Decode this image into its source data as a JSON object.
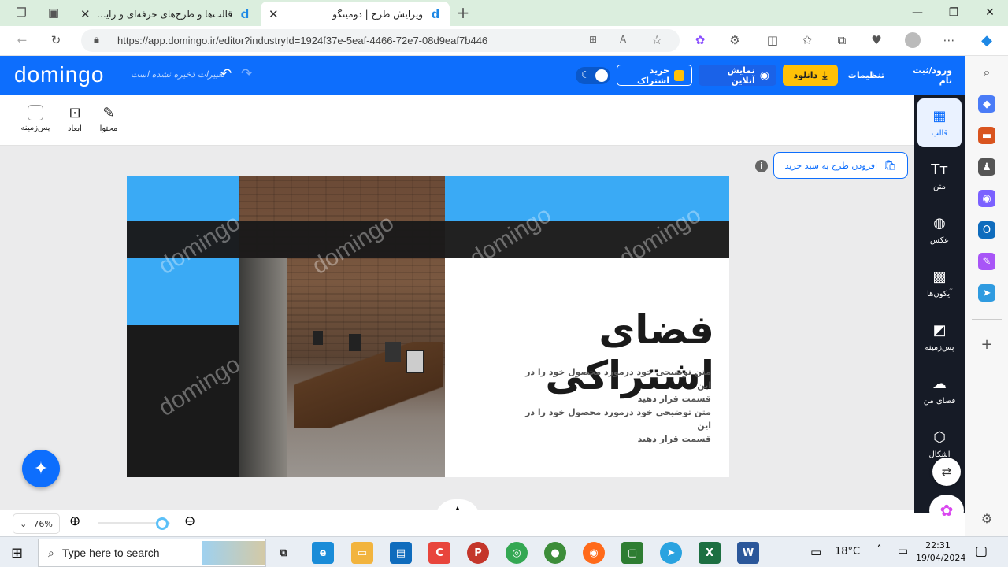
{
  "browser": {
    "tabs": [
      {
        "title": "قالب‌ها و طرح‌های حرفه‌ای و رایگان",
        "favicon": "domingo-icon",
        "active": false
      },
      {
        "title": "ویرایش طرح | دومینگو",
        "favicon": "domingo-icon",
        "active": true
      }
    ],
    "new_tab_icon": "+",
    "url": "https://app.domingo.ir/editor?industryId=1924f37e-5eaf-4466-72e7-08d9eaf7b446"
  },
  "app": {
    "logo": "domingo",
    "save_status": "تغییرات ذخیره نشده است",
    "buttons": {
      "login": "ورود/ثبت نام",
      "settings": "تنظیمات",
      "download": "دانلود",
      "preview": "نمایش آنلاین",
      "subscribe": "خرید اشتراک"
    },
    "colors": {
      "brand": "#0d6efd",
      "download": "#ffc107",
      "dark_sidebar": "#161b26"
    }
  },
  "tools": [
    {
      "label": "قالب",
      "icon": "template-icon",
      "active": true
    },
    {
      "label": "متن",
      "icon": "text-icon",
      "active": false
    },
    {
      "label": "عکس",
      "icon": "image-icon",
      "active": false
    },
    {
      "label": "آیکون‌ها",
      "icon": "grid-icon",
      "active": false
    },
    {
      "label": "پس‌زمینه",
      "icon": "background-icon",
      "active": false
    },
    {
      "label": "فضای من",
      "icon": "cloud-upload-icon",
      "active": false
    },
    {
      "label": "اشکال",
      "icon": "shapes-icon",
      "active": false
    }
  ],
  "subbar": {
    "content": "محتوا",
    "dimensions": "ابعاد",
    "background": "پس‌زمینه"
  },
  "add_to_cart": "افزودن طرح به سبد خرید",
  "design": {
    "heading": "فضای اشتراکی",
    "body_lines": [
      "متن توضیحی خود درمورد محصول خود را در این",
      "قسمت قرار دهید",
      "متن توضیحی خود درمورد محصول خود را در این",
      "قسمت قرار دهید"
    ],
    "watermark": "domingo"
  },
  "zoom": {
    "value": "76%",
    "level": 0.76
  },
  "taskbar": {
    "search_placeholder": "Type here to search",
    "weather": "18°C",
    "time": "22:31",
    "date": "19/04/2024"
  }
}
